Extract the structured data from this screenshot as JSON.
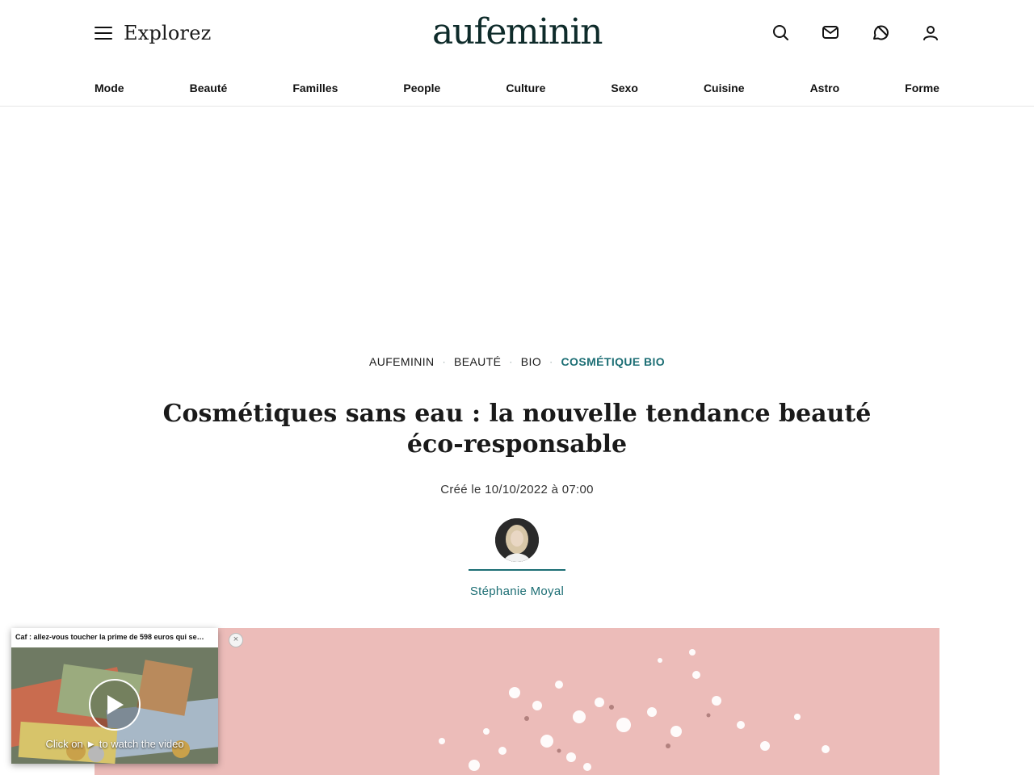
{
  "header": {
    "menu_label": "Explorez",
    "logo": "aufeminin",
    "icons": [
      "search-icon",
      "mail-icon",
      "chat-icon",
      "user-icon"
    ]
  },
  "nav": {
    "items": [
      "Mode",
      "Beauté",
      "Familles",
      "People",
      "Culture",
      "Sexo",
      "Cuisine",
      "Astro",
      "Forme"
    ]
  },
  "breadcrumb": {
    "items": [
      "AUFEMININ",
      "BEAUTÉ",
      "BIO",
      "COSMÉTIQUE BIO"
    ],
    "separator": "·"
  },
  "article": {
    "title": "Cosmétiques sans eau : la nouvelle tendance beauté éco-responsable",
    "date": "Créé le 10/10/2022 à 07:00",
    "author": "Stéphanie Moyal"
  },
  "video_popup": {
    "title": "Caf : allez-vous toucher la prime de 598 euros qui se…",
    "cta": "Click on ► to watch the video",
    "close": "×"
  },
  "colors": {
    "accent": "#1c6e74",
    "logo": "#0e2b2a",
    "hero_bg": "#ecbcb9"
  }
}
